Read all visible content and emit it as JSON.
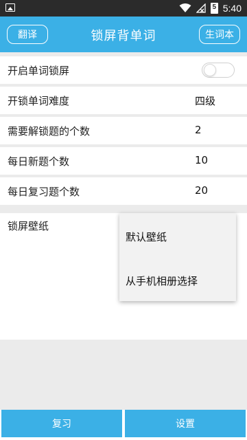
{
  "status_bar": {
    "time": "5:40",
    "battery_level": "5"
  },
  "app_bar": {
    "title": "锁屏背单词",
    "left_button": "翻译",
    "right_button": "生词本"
  },
  "settings": {
    "lock_toggle_label": "开启单词锁屏",
    "lock_toggle_on": false,
    "rows": [
      {
        "label": "开锁单词难度",
        "value": "四级"
      },
      {
        "label": "需要解锁题的个数",
        "value": "2"
      },
      {
        "label": "每日新题个数",
        "value": "10"
      },
      {
        "label": "每日复习题个数",
        "value": "20"
      }
    ],
    "wallpaper_label": "锁屏壁纸"
  },
  "wallpaper_menu": {
    "items": [
      "默认壁纸",
      "从手机相册选择"
    ]
  },
  "bottom_tabs": {
    "review": "复习",
    "settings": "设置"
  },
  "colors": {
    "accent": "#3bb0e6",
    "status_bar": "#2b2b2b"
  }
}
